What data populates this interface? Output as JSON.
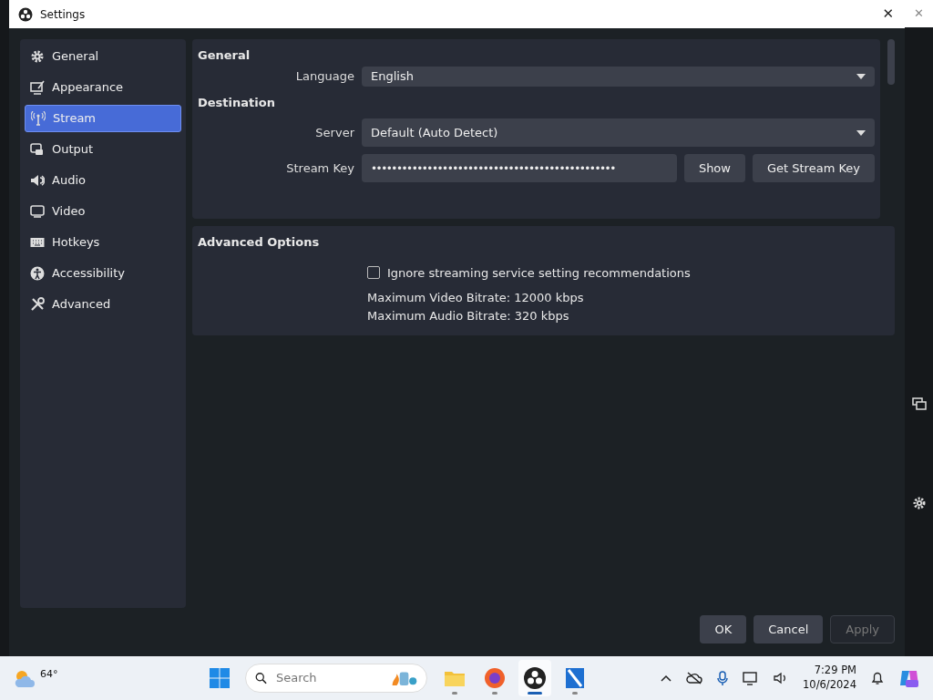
{
  "window": {
    "title": "Settings",
    "close": "✕"
  },
  "background_window": {
    "close": "✕"
  },
  "sidebar": {
    "items": [
      {
        "label": "General",
        "selected": false
      },
      {
        "label": "Appearance",
        "selected": false
      },
      {
        "label": "Stream",
        "selected": true
      },
      {
        "label": "Output",
        "selected": false
      },
      {
        "label": "Audio",
        "selected": false
      },
      {
        "label": "Video",
        "selected": false
      },
      {
        "label": "Hotkeys",
        "selected": false
      },
      {
        "label": "Accessibility",
        "selected": false
      },
      {
        "label": "Advanced",
        "selected": false
      }
    ]
  },
  "general": {
    "heading": "General",
    "language_label": "Language",
    "language_value": "English"
  },
  "destination": {
    "heading": "Destination",
    "server_label": "Server",
    "server_value": "Default (Auto Detect)",
    "key_label": "Stream Key",
    "key_value": "••••••••••••••••••••••••••••••••••••••••••••••••",
    "show_button": "Show",
    "get_key_button": "Get Stream Key"
  },
  "advanced": {
    "heading": "Advanced Options",
    "ignore_label": "Ignore streaming service setting recommendations",
    "ignore_checked": false,
    "video_bitrate": "Maximum Video Bitrate: 12000 kbps",
    "audio_bitrate": "Maximum Audio Bitrate: 320 kbps"
  },
  "buttons": [
    {
      "label": "OK",
      "disabled": false
    },
    {
      "label": "Cancel",
      "disabled": false
    },
    {
      "label": "Apply",
      "disabled": true
    }
  ],
  "taskbar": {
    "temperature": "64°",
    "search_placeholder": "Search",
    "apps": [
      {
        "selected": false
      },
      {
        "selected": false
      },
      {
        "selected": true
      },
      {
        "selected": false
      }
    ],
    "time": "7:29 PM",
    "date": "10/6/2024"
  }
}
